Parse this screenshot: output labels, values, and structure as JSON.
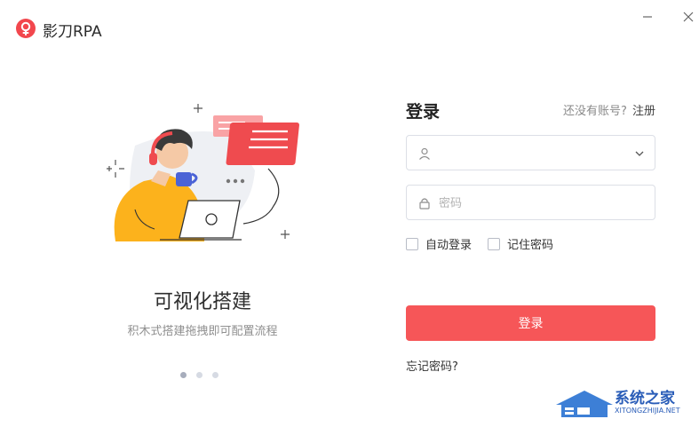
{
  "window": {
    "app_title": "影刀RPA"
  },
  "carousel": {
    "slide_title": "可视化搭建",
    "slide_subtitle": "积木式搭建拖拽即可配置流程",
    "dot_count": 3,
    "active_index": 0
  },
  "login": {
    "title": "登录",
    "no_account_prompt": "还没有账号?",
    "register_link": "注册",
    "username": {
      "value": "",
      "placeholder": ""
    },
    "password": {
      "value": "",
      "placeholder": "密码"
    },
    "auto_login_label": "自动登录",
    "auto_login_checked": false,
    "remember_label": "记住密码",
    "remember_checked": false,
    "submit_label": "登录",
    "forgot_label": "忘记密码?"
  },
  "watermark": {
    "title": "系统之家",
    "url": "XITONGZHIJIA.NET"
  },
  "colors": {
    "accent": "#f65658",
    "illustration_orange": "#fcb21c",
    "illustration_red": "#ef4b4f"
  },
  "icons": [
    "app-logo-icon",
    "minimize-icon",
    "close-icon",
    "user-icon",
    "chevron-down-icon",
    "lock-icon"
  ]
}
